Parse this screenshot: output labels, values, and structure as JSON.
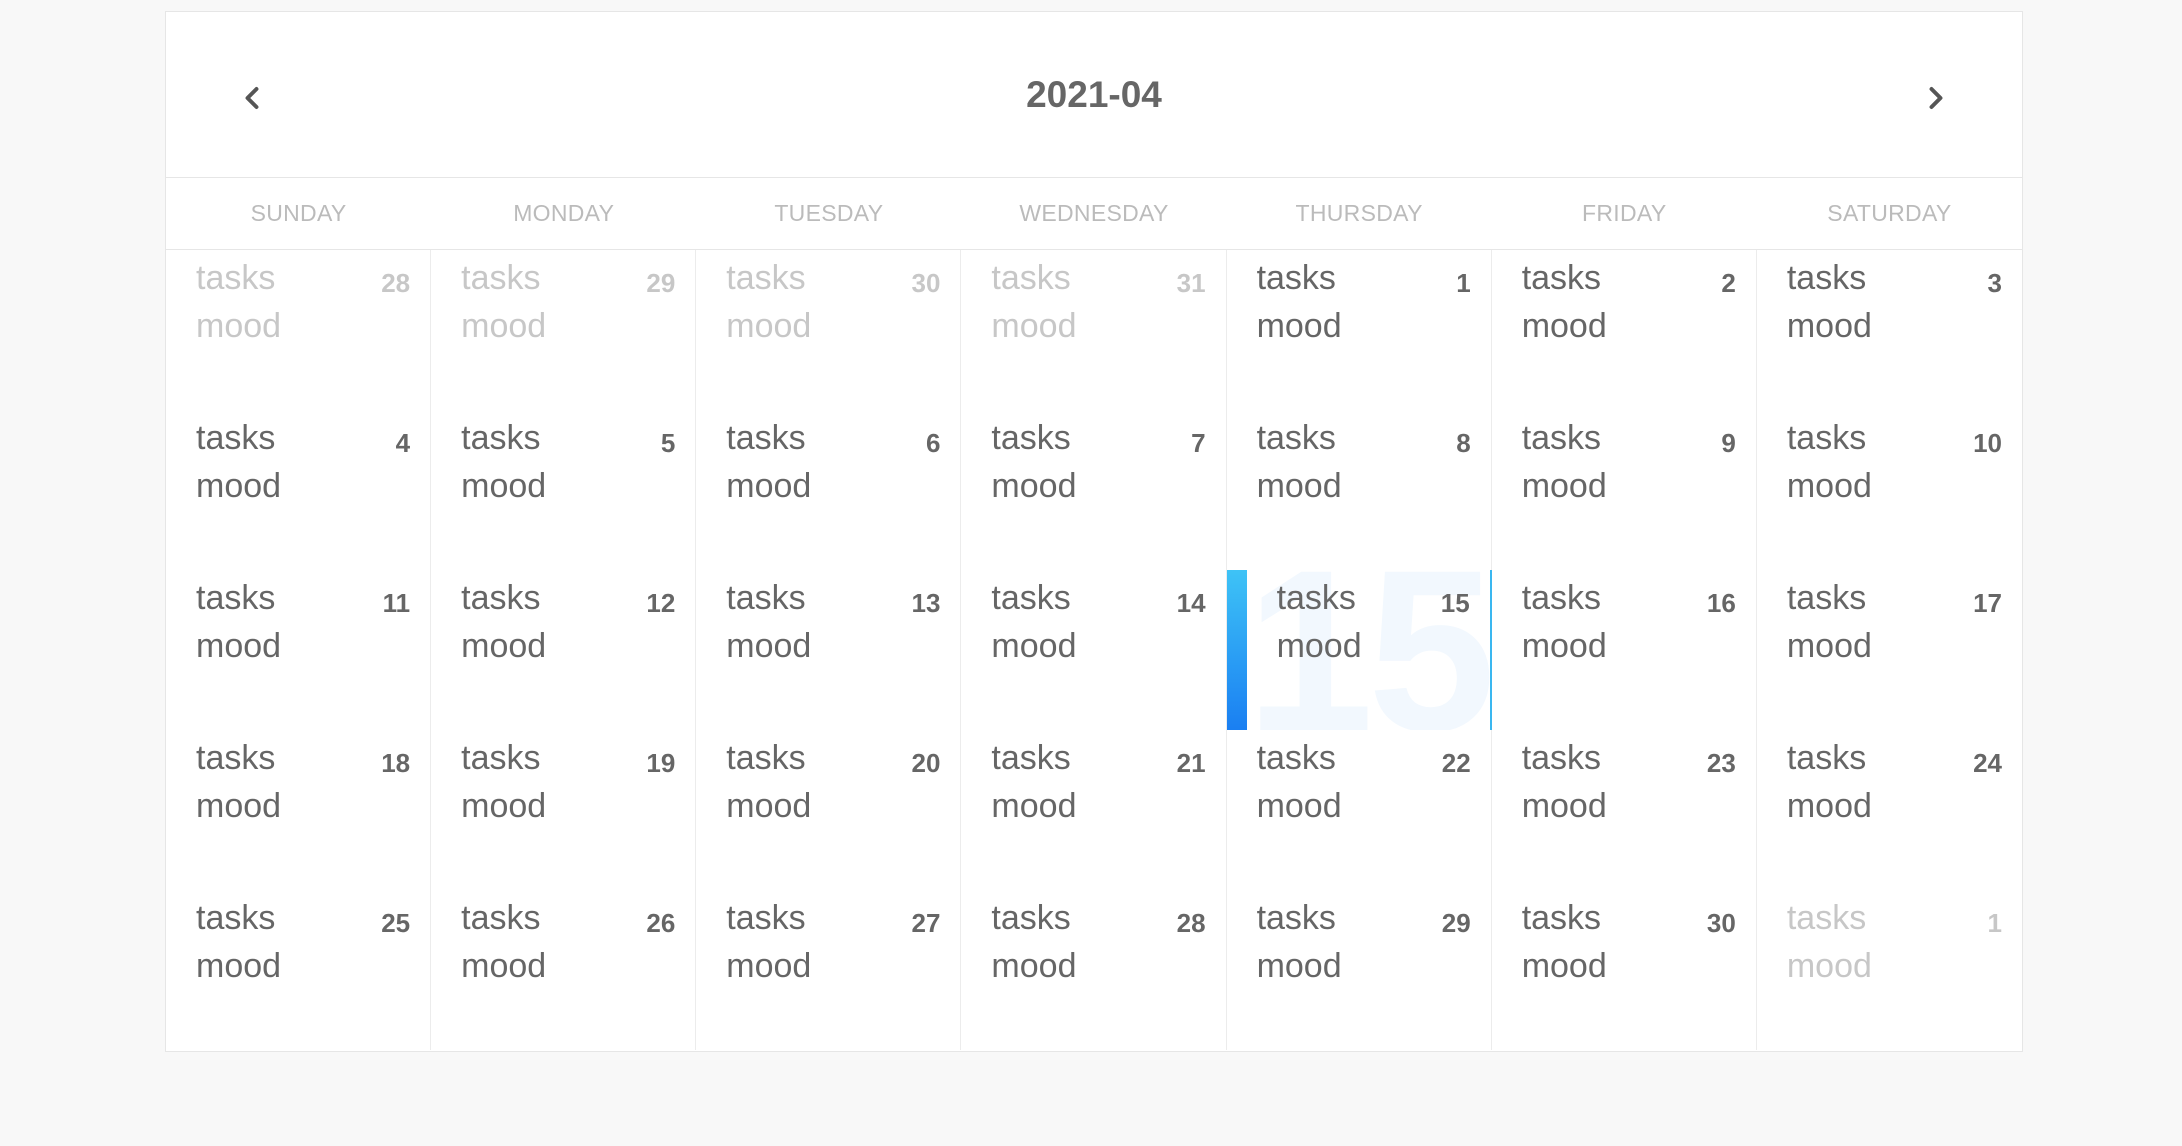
{
  "header": {
    "title": "2021-04",
    "prev_icon": "chevron-left-icon",
    "next_icon": "chevron-right-icon"
  },
  "weekdays": [
    "SUNDAY",
    "MONDAY",
    "TUESDAY",
    "WEDNESDAY",
    "THURSDAY",
    "FRIDAY",
    "SATURDAY"
  ],
  "labels": {
    "tasks": "tasks",
    "mood": "mood"
  },
  "today": "15",
  "colors": {
    "accent_top": "#3ec3f6",
    "accent_bottom": "#1a7ff2",
    "text": "#666666",
    "muted": "#c7c7c7"
  },
  "days": [
    {
      "num": "28",
      "muted": true
    },
    {
      "num": "29",
      "muted": true
    },
    {
      "num": "30",
      "muted": true
    },
    {
      "num": "31",
      "muted": true
    },
    {
      "num": "1"
    },
    {
      "num": "2"
    },
    {
      "num": "3"
    },
    {
      "num": "4"
    },
    {
      "num": "5"
    },
    {
      "num": "6"
    },
    {
      "num": "7"
    },
    {
      "num": "8"
    },
    {
      "num": "9"
    },
    {
      "num": "10"
    },
    {
      "num": "11"
    },
    {
      "num": "12"
    },
    {
      "num": "13"
    },
    {
      "num": "14"
    },
    {
      "num": "15",
      "today": true
    },
    {
      "num": "16"
    },
    {
      "num": "17"
    },
    {
      "num": "18"
    },
    {
      "num": "19"
    },
    {
      "num": "20"
    },
    {
      "num": "21"
    },
    {
      "num": "22"
    },
    {
      "num": "23"
    },
    {
      "num": "24"
    },
    {
      "num": "25"
    },
    {
      "num": "26"
    },
    {
      "num": "27"
    },
    {
      "num": "28"
    },
    {
      "num": "29"
    },
    {
      "num": "30"
    },
    {
      "num": "1",
      "muted": true
    }
  ]
}
